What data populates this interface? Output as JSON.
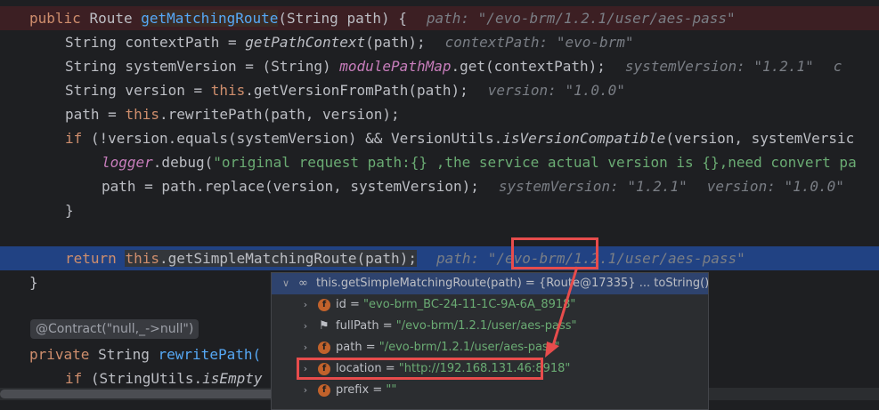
{
  "code": {
    "l1": {
      "kw": "public",
      "type": "Route",
      "method": "getMatchingRoute",
      "sig": "(String path) {",
      "hint": "path: \"/evo-brm/1.2.1/user/aes-pass\""
    },
    "l2": {
      "code_a": "String contextPath = ",
      "call": "getPathContext",
      "code_b": "(path);",
      "hint": "contextPath: \"evo-brm\""
    },
    "l3": {
      "code_a": "String systemVersion = (String) ",
      "field": "modulePathMap",
      "code_b": ".get(contextPath);",
      "hint": "systemVersion: \"1.2.1\"",
      "hint2": "c"
    },
    "l4": {
      "code_a": "String version = ",
      "kw": "this",
      "code_b": ".getVersionFromPath(path);",
      "hint": "version: \"1.0.0\""
    },
    "l5": {
      "code_a": "path = ",
      "kw": "this",
      "code_b": ".rewritePath(path, version);"
    },
    "l6": {
      "kw": "if",
      "code_a": " (!version.equals(systemVersion) && VersionUtils.",
      "call": "isVersionCompatible",
      "code_b": "(version, systemVersic"
    },
    "l7": {
      "field": "logger",
      "code_a": ".debug(",
      "str": "\"original request path:{} ,the service actual version is {},need convert pa"
    },
    "l8": {
      "code_a": "path = path.replace(version, systemVersion);",
      "hint": "systemVersion: \"1.2.1\"",
      "hint2": "version: \"1.0.0\""
    },
    "l9": {
      "code_a": "}"
    },
    "l11": {
      "kw": "return",
      "kw2": "this",
      "code_a": ".getSimpleMatchingRoute(path);",
      "hint": "path: \"/evo-brm/1.2.1/user/aes-pass\""
    },
    "l12": {
      "code_a": "}"
    },
    "contract": "@Contract(\"null,_->null\")",
    "l15": {
      "kw": "private",
      "type": "String",
      "method": "rewritePath("
    },
    "l16": {
      "kw": "if",
      "code_a": " (StringUtils.",
      "call": "isEmpty"
    }
  },
  "popup": {
    "header": {
      "expr": "this.getSimpleMatchingRoute(path) = {Route@17335}",
      "link": "... toString()"
    },
    "fields": [
      {
        "name": "id",
        "value": "\"evo-brm_BC-24-11-1C-9A-6A_8918\"",
        "icon": "field-icon"
      },
      {
        "name": "fullPath",
        "value": "\"/evo-brm/1.2.1/user/aes-pass\"",
        "icon": "flag-icon"
      },
      {
        "name": "path",
        "value": "\"/evo-brm/1.2.1/user/aes-pass\"",
        "icon": "field-icon"
      },
      {
        "name": "location",
        "value": "\"http://192.168.131.46:8918\"",
        "icon": "field-icon"
      },
      {
        "name": "prefix",
        "value": "\"\"",
        "icon": "field-icon"
      }
    ],
    "eq": " = "
  },
  "colors": {
    "annotation": "#e74c4c",
    "highlight": "#214283",
    "exec_line": "#3c1f23"
  }
}
